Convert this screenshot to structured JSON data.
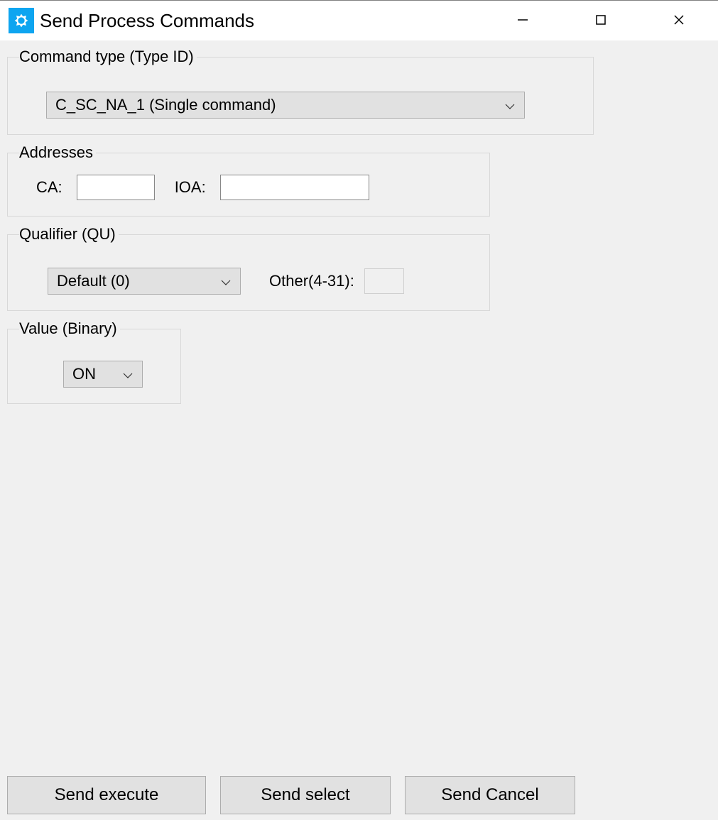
{
  "window": {
    "title": "Send Process Commands"
  },
  "groups": {
    "command_type": {
      "legend": "Command type (Type ID)",
      "selected": "C_SC_NA_1 (Single command)"
    },
    "addresses": {
      "legend": "Addresses",
      "ca_label": "CA:",
      "ca_value": "",
      "ioa_label": "IOA:",
      "ioa_value": ""
    },
    "qualifier": {
      "legend": "Qualifier (QU)",
      "selected": "Default (0)",
      "other_label": "Other(4-31):",
      "other_value": ""
    },
    "value": {
      "legend": "Value (Binary)",
      "selected": "ON"
    }
  },
  "buttons": {
    "execute": "Send execute",
    "select": "Send select",
    "cancel": "Send Cancel"
  }
}
